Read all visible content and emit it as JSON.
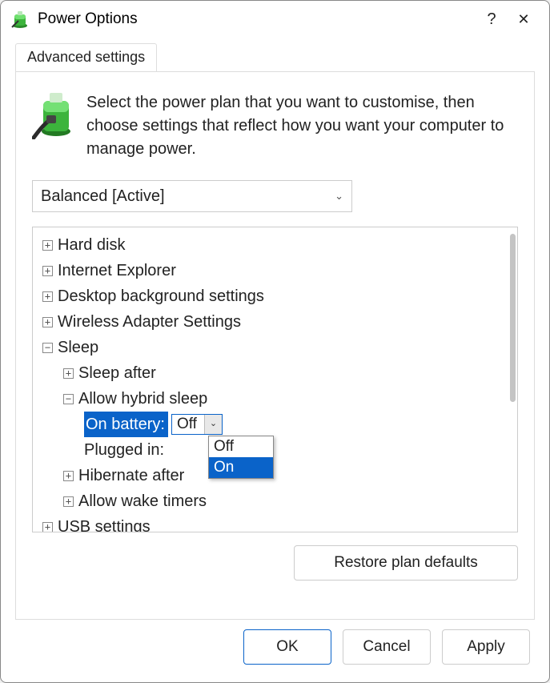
{
  "window": {
    "title": "Power Options",
    "help_glyph": "?",
    "close_glyph": "✕"
  },
  "tab": {
    "label": "Advanced settings"
  },
  "intro": "Select the power plan that you want to customise, then choose settings that reflect how you want your computer to manage power.",
  "plan_selected": "Balanced [Active]",
  "tree": {
    "hard_disk": "Hard disk",
    "ie": "Internet Explorer",
    "desktop_bg": "Desktop background settings",
    "wireless": "Wireless Adapter Settings",
    "sleep": "Sleep",
    "sleep_after": "Sleep after",
    "hybrid": "Allow hybrid sleep",
    "on_battery_label": "On battery:",
    "on_battery_value": "Off",
    "plugged_in_label": "Plugged in:",
    "hibernate_after": "Hibernate after",
    "wake_timers": "Allow wake timers",
    "usb": "USB settings"
  },
  "dropdown": {
    "opt_off": "Off",
    "opt_on": "On"
  },
  "buttons": {
    "restore": "Restore plan defaults",
    "ok": "OK",
    "cancel": "Cancel",
    "apply": "Apply"
  },
  "glyphs": {
    "plus": "+",
    "minus": "−",
    "chev": "⌄"
  }
}
